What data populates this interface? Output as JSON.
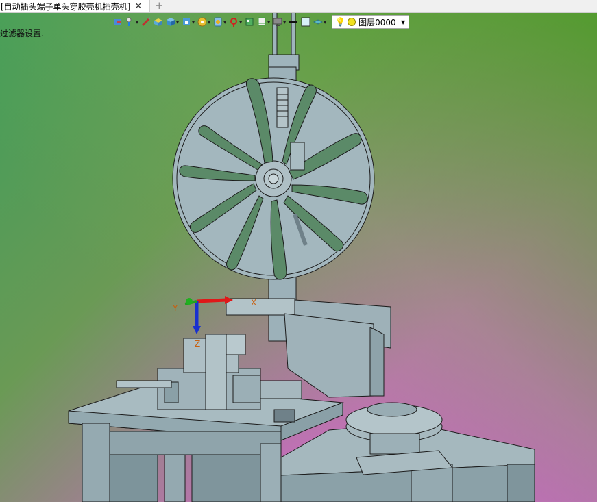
{
  "tab": {
    "title": "[自动插头端子单头穿胶壳机插壳机]",
    "close": "✕",
    "add": "+"
  },
  "status": {
    "text": "过滤器设置."
  },
  "layer": {
    "name": "图层0000"
  },
  "triad": {
    "x": "X",
    "y": "Y",
    "z": "Z"
  },
  "colors": {
    "accent": "#2a6edb",
    "model": "#9fb4bc",
    "edge": "#1b1b1b"
  },
  "toolbar": {
    "icons": [
      "sketch-icon",
      "pointer-icon",
      "pen-icon",
      "box-icon",
      "cube-icon",
      "view-cube-icon",
      "settings-gear-icon",
      "display-icon",
      "pin-icon",
      "section-icon",
      "monitor-icon",
      "line-weight-icon",
      "color-swatch-icon",
      "material-icon"
    ]
  }
}
